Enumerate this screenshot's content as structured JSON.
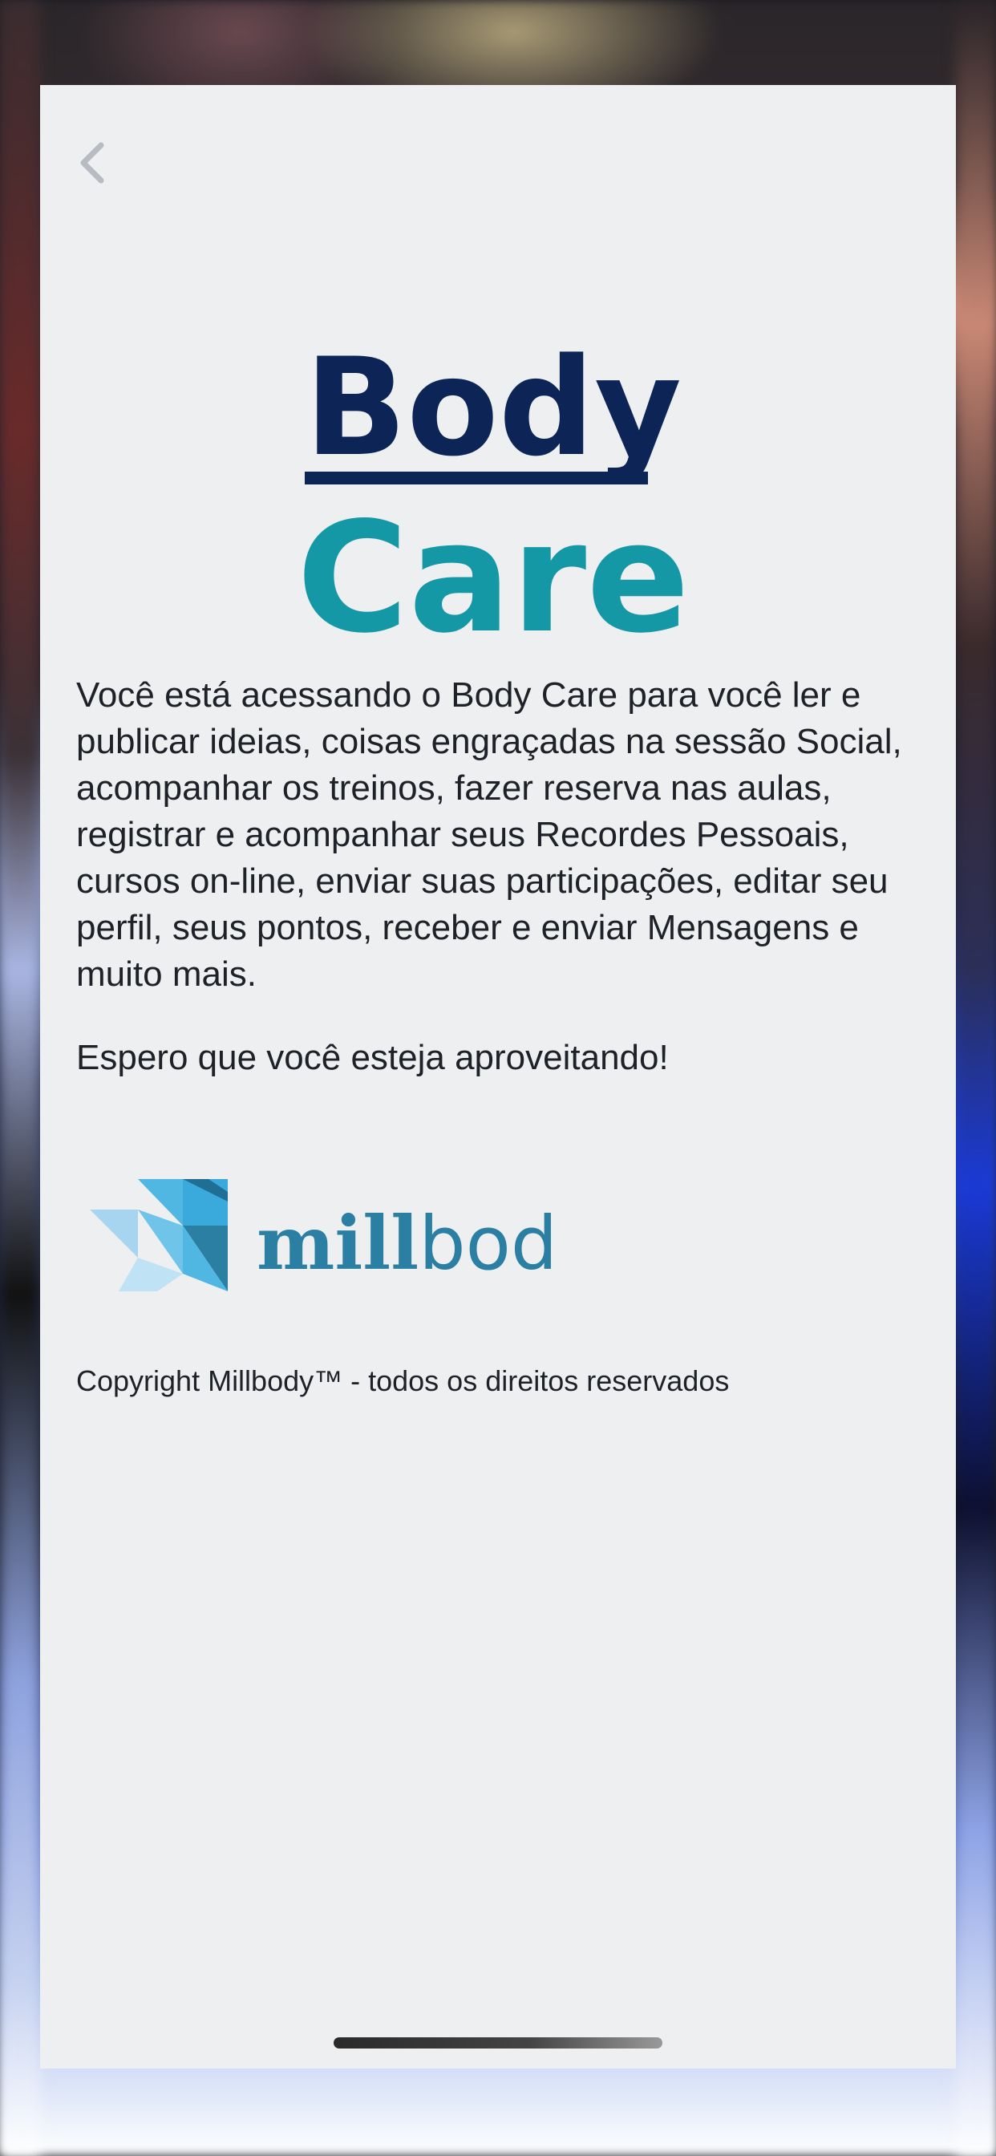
{
  "header": {
    "back_icon": "chevron-left-icon"
  },
  "logo": {
    "line1": "Body",
    "line2": "Care",
    "colors": {
      "body": "#0d2556",
      "care": "#1598a6"
    }
  },
  "content": {
    "description": "Você está acessando o Body Care para você ler e publicar ideias, coisas engraçadas na sessão Social, acompanhar os treinos, fazer reserva nas aulas, registrar e acompanhar seus Recordes Pessoais, cursos on-line, enviar suas participações, editar seu perfil, seus pontos, receber e enviar Mensagens e muito mais.",
    "greeting": "Espero que você esteja aproveitando!"
  },
  "brand": {
    "name_bold": "mill",
    "name_light": "body",
    "color": "#2a7fa3"
  },
  "footer": {
    "copyright": "Copyright Millbody™ - todos os direitos reservados"
  }
}
